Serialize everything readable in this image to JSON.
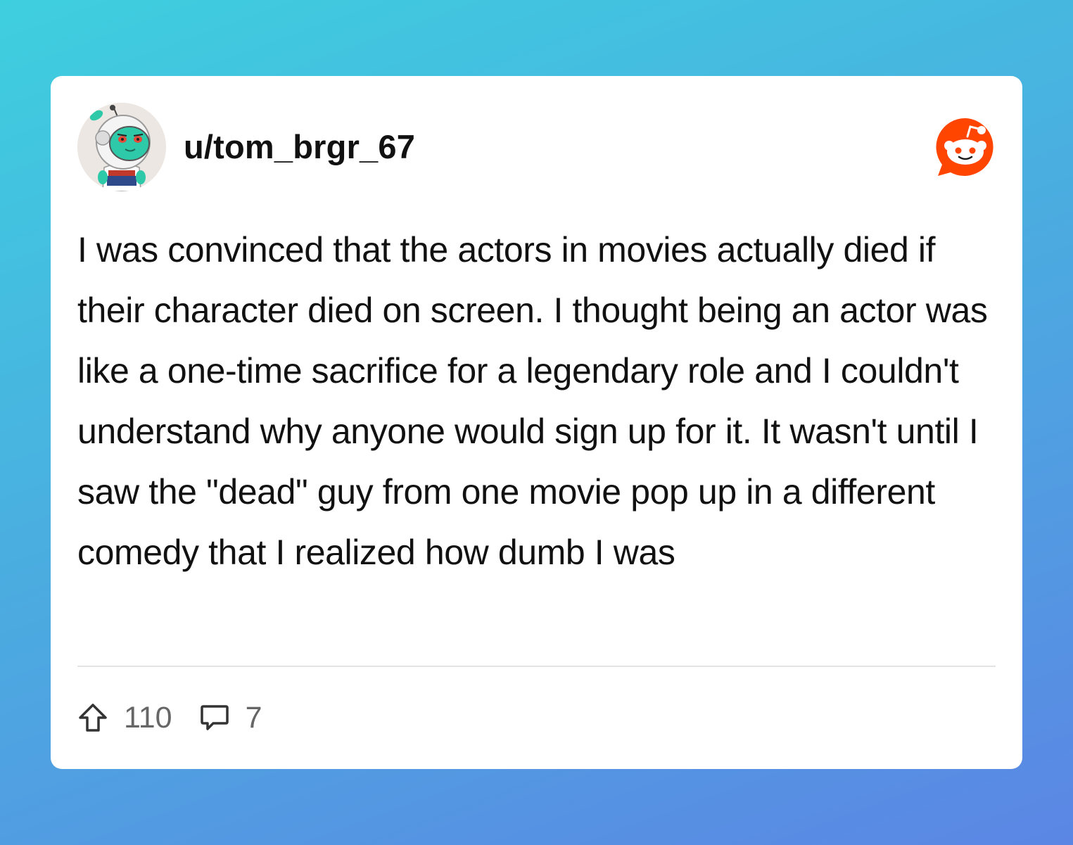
{
  "post": {
    "username": "u/tom_brgr_67",
    "body": "I was convinced that the actors in movies actually died if their character died on screen. I thought being an actor was like a one-time sacrifice for a legendary role and I couldn't understand why anyone would sign up for it. It wasn't until I saw the \"dead\" guy from one movie pop up in a different comedy that I realized how dumb I was",
    "upvotes": "110",
    "comments": "7"
  },
  "icons": {
    "avatar": "snoo-astronaut-avatar",
    "brand": "reddit-logo-icon",
    "upvote": "upvote-arrow-icon",
    "comment": "comment-bubble-icon"
  },
  "colors": {
    "brand": "#ff4500",
    "avatar_skin": "#2ec9a8",
    "meta_text": "#666666"
  }
}
